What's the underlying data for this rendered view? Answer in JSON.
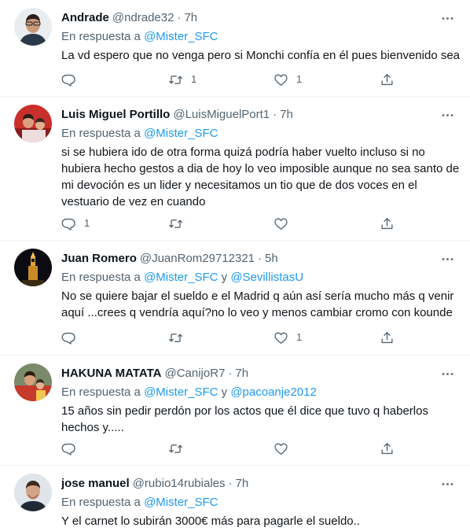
{
  "tweets": [
    {
      "name": "Andrade",
      "handle": "@ndrade32",
      "sep": "·",
      "time": "7h",
      "reply_prefix": "En respuesta a",
      "mention1": "@Mister_SFC",
      "text": "La vd espero que no venga pero si Monchi confía en él pues bienvenido sea",
      "replies": "",
      "retweets": "1",
      "likes": "1"
    },
    {
      "name": "Luis Miguel Portillo",
      "handle": "@LuisMiguelPort1",
      "sep": "·",
      "time": "7h",
      "reply_prefix": "En respuesta a",
      "mention1": "@Mister_SFC",
      "text": "si se hubiera ido de otra forma quizá podría haber vuelto incluso si no hubiera hecho gestos a dia de hoy lo veo imposible aunque no sea santo de mi devoción es un lider y necesitamos un tio que de dos voces en el vestuario de vez en cuando",
      "replies": "1",
      "retweets": "",
      "likes": ""
    },
    {
      "name": "Juan Romero",
      "handle": "@JuanRom29712321",
      "sep": "·",
      "time": "5h",
      "reply_prefix": "En respuesta a",
      "mention1": "@Mister_SFC",
      "conj": "y",
      "mention2": "@SevillistasU",
      "text": "No se quiere bajar el sueldo e el Madrid q aún así sería mucho más q venir aquí ...crees q vendría aquí?no lo veo y menos cambiar cromo con kounde",
      "replies": "",
      "retweets": "",
      "likes": "1"
    },
    {
      "name": "HAKUNA MATATA",
      "handle": "@CanijoR7",
      "sep": "·",
      "time": "7h",
      "reply_prefix": "En respuesta a",
      "mention1": "@Mister_SFC",
      "conj": "y",
      "mention2": "@pacoanje2012",
      "text": "15 años sin pedir perdón por los actos que él dice que tuvo q haberlos hechos y.....",
      "replies": "",
      "retweets": "",
      "likes": ""
    },
    {
      "name": "jose manuel",
      "handle": "@rubio14rubiales",
      "sep": "·",
      "time": "7h",
      "reply_prefix": "En respuesta a",
      "mention1": "@Mister_SFC",
      "text": "Y el carnet lo subirán 3000€ más para pagarle el sueldo..",
      "replies": "",
      "retweets": "",
      "likes": ""
    }
  ],
  "icons": {
    "more": "more-horizontal-icon",
    "reply": "reply-icon",
    "retweet": "retweet-icon",
    "like": "heart-icon",
    "share": "share-icon"
  },
  "colors": {
    "text": "#0f1419",
    "secondary": "#536471",
    "link": "#1d9bf0",
    "divider": "#eff3f4"
  }
}
